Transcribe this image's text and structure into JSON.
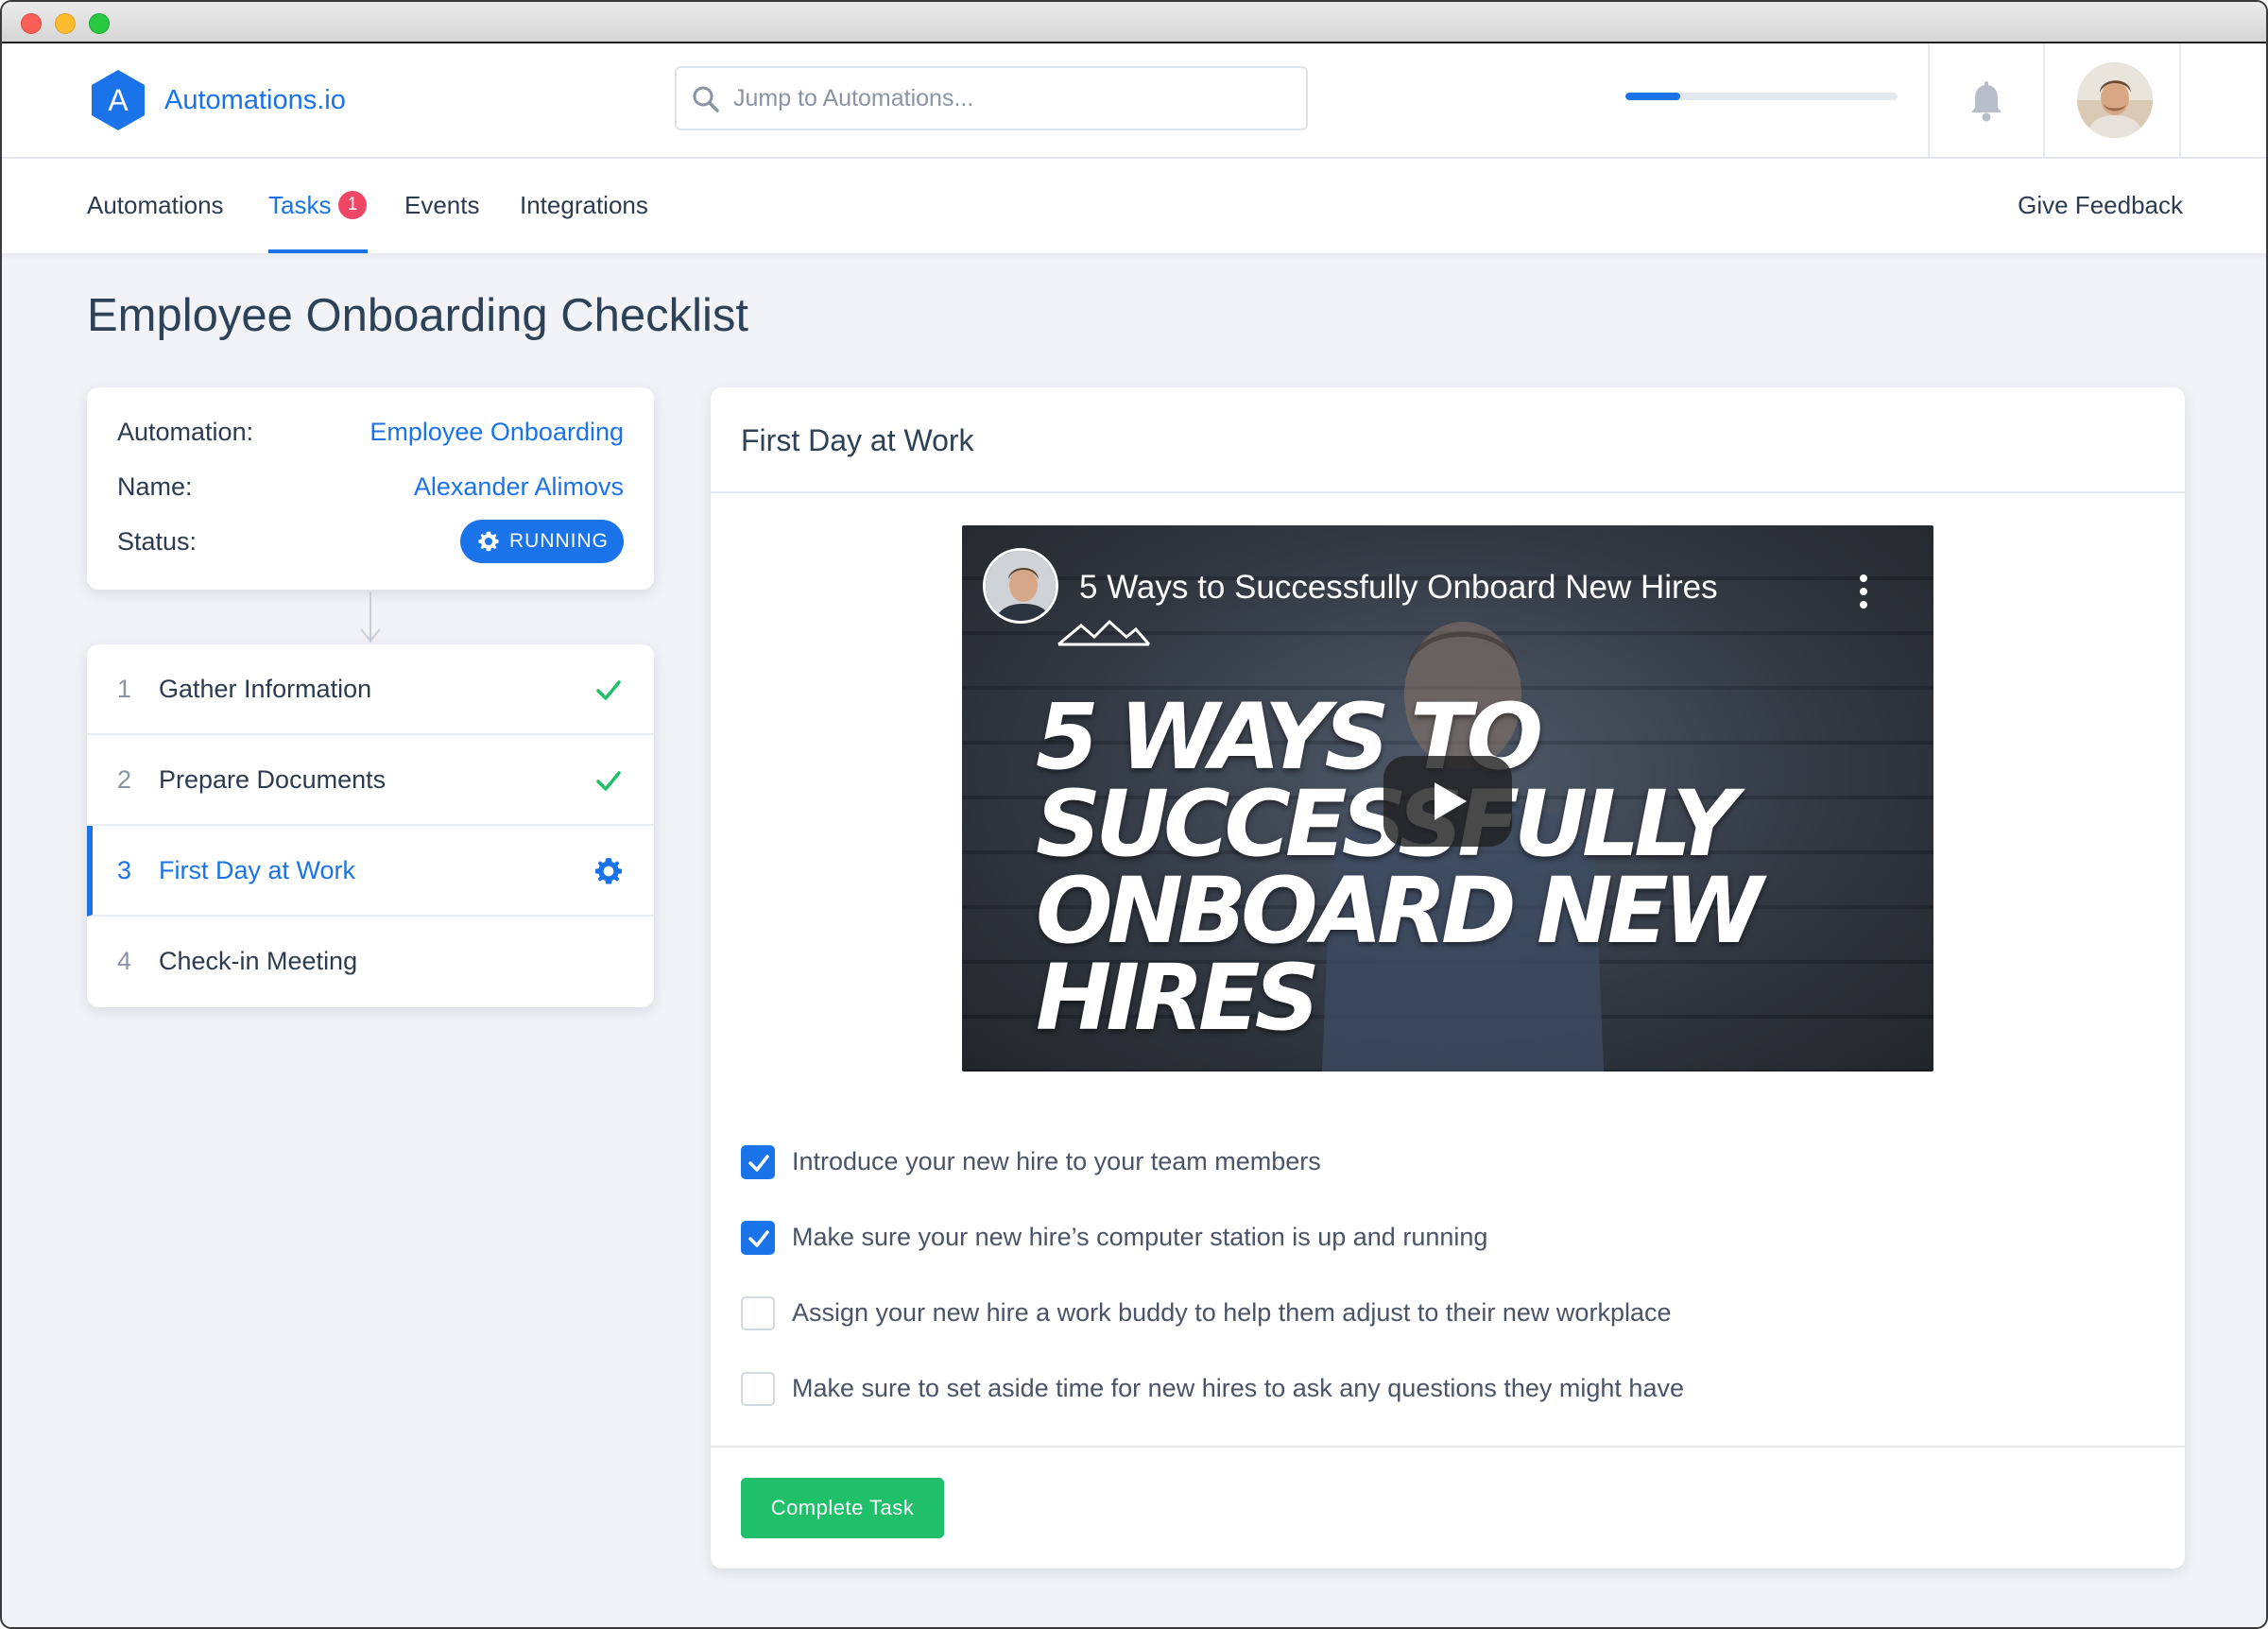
{
  "app": {
    "name": "Automations.io",
    "logo_letter": "A",
    "brand_color": "#1a73e8"
  },
  "search": {
    "placeholder": "Jump to Automations..."
  },
  "header": {
    "progress_fraction": 0.2
  },
  "nav": {
    "items": [
      {
        "label": "Automations"
      },
      {
        "label": "Tasks",
        "badge": "1"
      },
      {
        "label": "Events"
      },
      {
        "label": "Integrations"
      }
    ],
    "active": "Tasks",
    "feedback": "Give Feedback"
  },
  "page": {
    "title": "Employee Onboarding Checklist"
  },
  "info": {
    "automation_label": "Automation:",
    "automation_value": "Employee Onboarding",
    "name_label": "Name:",
    "name_value": "Alexander Alimovs",
    "status_label": "Status:",
    "status_value": "RUNNING"
  },
  "steps": [
    {
      "num": "1",
      "label": "Gather Information",
      "state": "done",
      "icon": "check-icon"
    },
    {
      "num": "2",
      "label": "Prepare Documents",
      "state": "done",
      "icon": "check-icon"
    },
    {
      "num": "3",
      "label": "First Day at Work",
      "state": "current",
      "icon": "gear-icon"
    },
    {
      "num": "4",
      "label": "Check-in Meeting",
      "state": "pending"
    }
  ],
  "task": {
    "title": "First Day at Work",
    "video": {
      "title": "5 Ways to Successfully Onboard New Hires",
      "headline_1": "5 WAYS TO",
      "headline_2": "SUCCESSFULLY",
      "headline_3": "ONBOARD NEW HIRES"
    },
    "checklist": [
      {
        "label": "Introduce your new hire to your team members",
        "checked": true
      },
      {
        "label": "Make sure your new hire’s computer station is up and running",
        "checked": true
      },
      {
        "label": "Assign your new hire a work buddy to help them adjust to their new workplace",
        "checked": false
      },
      {
        "label": "Make sure to set aside time for new hires to ask any questions they might have",
        "checked": false
      }
    ],
    "complete_label": "Complete Task"
  },
  "colors": {
    "accent": "#1a73e8",
    "success": "#20c06a",
    "badge": "#ef4765"
  }
}
